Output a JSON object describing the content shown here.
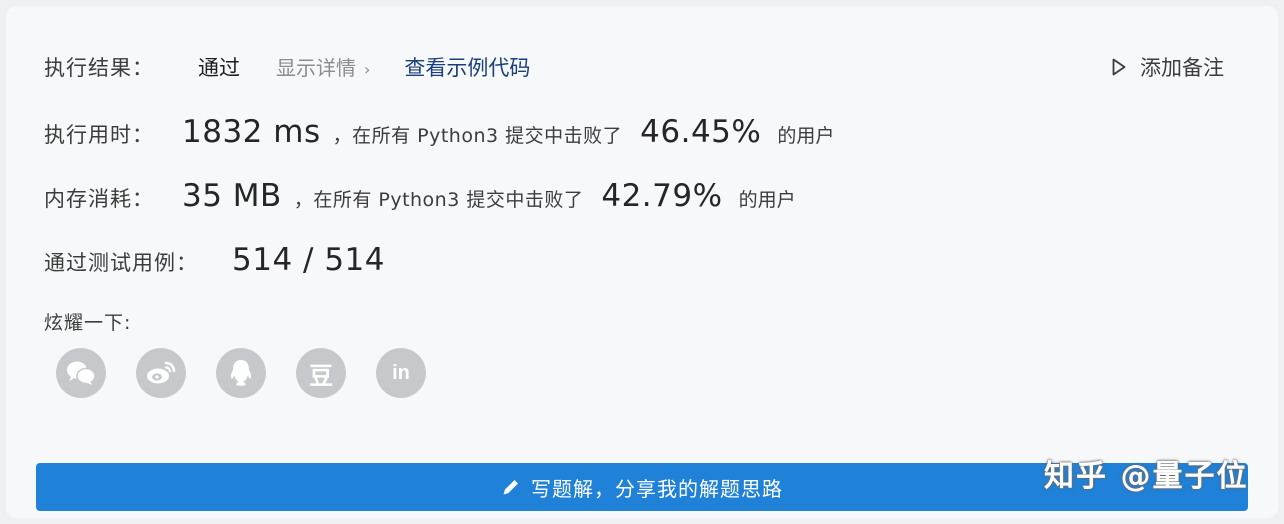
{
  "result": {
    "label": "执行结果：",
    "status": "通过",
    "detail_label": "显示详情",
    "detail_chevron": "›",
    "sample_code_label": "查看示例代码"
  },
  "note": {
    "label": "添加备注",
    "icon": "play-outline-icon"
  },
  "runtime": {
    "label": "执行用时：",
    "value": "1832 ms",
    "middle": "，在所有 Python3 提交中击败了",
    "percent": "46.45%",
    "suffix": "的用户"
  },
  "memory": {
    "label": "内存消耗：",
    "value": "35 MB",
    "middle": "，在所有 Python3 提交中击败了",
    "percent": "42.79%",
    "suffix": "的用户"
  },
  "testcases": {
    "label": "通过测试用例：",
    "value": "514 / 514"
  },
  "share": {
    "label": "炫耀一下:",
    "icons": [
      "wechat-icon",
      "weibo-icon",
      "qq-icon",
      "douban-icon",
      "linkedin-icon"
    ],
    "douban_glyph": "豆",
    "linkedin_glyph": "in"
  },
  "write_solution": {
    "label": "写题解，分享我的解题思路",
    "icon": "pencil-icon"
  },
  "watermark": {
    "text": "知乎 @量子位"
  },
  "colors": {
    "accent": "#1f81d8",
    "link": "#1b3f7c",
    "icon_bg": "#c6c8cc",
    "muted": "#8c8c8c"
  }
}
